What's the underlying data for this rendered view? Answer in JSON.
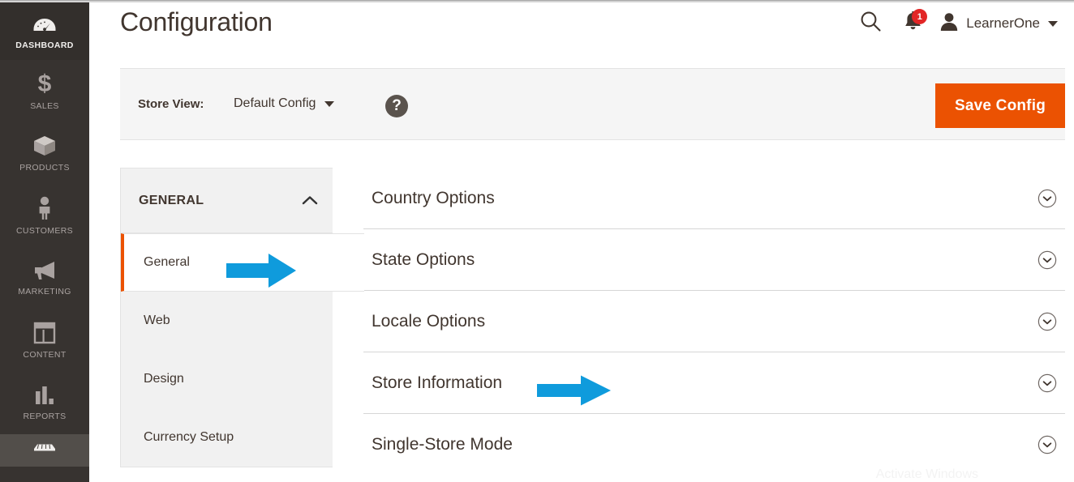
{
  "app": {
    "page_title": "Configuration",
    "accent_orange": "#eb5202",
    "sidebar_bg": "#373330",
    "arrow_blue": "#0f9bdc",
    "badge_red": "#e22626"
  },
  "sidebar": {
    "items": [
      {
        "label": "DASHBOARD",
        "icon": "gauge-icon",
        "state": "active"
      },
      {
        "label": "SALES",
        "icon": "dollar-icon",
        "state": "normal"
      },
      {
        "label": "PRODUCTS",
        "icon": "box-icon",
        "state": "normal"
      },
      {
        "label": "CUSTOMERS",
        "icon": "person-icon",
        "state": "normal"
      },
      {
        "label": "MARKETING",
        "icon": "megaphone-icon",
        "state": "normal"
      },
      {
        "label": "CONTENT",
        "icon": "layout-icon",
        "state": "normal"
      },
      {
        "label": "REPORTS",
        "icon": "bar-chart-icon",
        "state": "normal"
      },
      {
        "label": "",
        "icon": "store-icon",
        "state": "highlight"
      }
    ]
  },
  "header": {
    "search_icon": "search-icon",
    "notifications": {
      "icon": "bell-icon",
      "count": "1"
    },
    "user": {
      "avatar_icon": "user-avatar-icon",
      "name": "LearnerOne",
      "caret_icon": "caret-down-icon"
    }
  },
  "storeview": {
    "label": "Store View:",
    "value": "Default Config",
    "caret_icon": "caret-down-icon",
    "help_icon": "question-mark-icon",
    "help_glyph": "?",
    "save_label": "Save Config"
  },
  "config_nav": {
    "section_title": "GENERAL",
    "section_chevron": "chevron-up-icon",
    "items": [
      {
        "label": "General",
        "active": true
      },
      {
        "label": "Web",
        "active": false
      },
      {
        "label": "Design",
        "active": false
      },
      {
        "label": "Currency Setup",
        "active": false
      }
    ]
  },
  "config_groups": [
    {
      "title": "Country Options",
      "toggle_icon": "chevron-down-circle-icon"
    },
    {
      "title": "State Options",
      "toggle_icon": "chevron-down-circle-icon"
    },
    {
      "title": "Locale Options",
      "toggle_icon": "chevron-down-circle-icon"
    },
    {
      "title": "Store Information",
      "toggle_icon": "chevron-down-circle-icon"
    },
    {
      "title": "Single-Store Mode",
      "toggle_icon": "chevron-down-circle-icon"
    }
  ],
  "annotations": [
    {
      "name": "arrow-pointing-to-general",
      "target": "General"
    },
    {
      "name": "arrow-pointing-to-store-information",
      "target": "Store Information"
    }
  ],
  "watermark": {
    "text": "Activate Windows"
  }
}
